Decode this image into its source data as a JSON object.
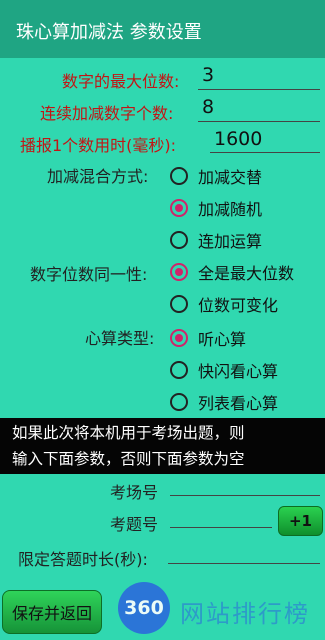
{
  "titlebar": {
    "title": "珠心算加减法 参数设置"
  },
  "fields": {
    "max_digits": {
      "label": "数字的最大位数:",
      "value": "3"
    },
    "count": {
      "label": "连续加减数字个数:",
      "value": "8"
    },
    "time": {
      "label": "播报1个数用时(毫秒):",
      "value": "1600"
    }
  },
  "mix_mode": {
    "label": "加减混合方式:",
    "options": [
      "加减交替",
      "加减随机",
      "连加运算"
    ],
    "selected": 1
  },
  "digit_mode": {
    "label": "数字位数同一性:",
    "options": [
      "全是最大位数",
      "位数可变化"
    ],
    "selected": 0
  },
  "calc_type": {
    "label": "心算类型:",
    "options": [
      "听心算",
      "快闪看心算",
      "列表看心算"
    ],
    "selected": 0
  },
  "notice": {
    "line1": "如果此次将本机用于考场出题，则",
    "line2": "输入下面参数，否则下面参数为空"
  },
  "exam": {
    "room_label": "考场号",
    "room_value": "",
    "question_label": "考题号",
    "question_value": "",
    "plus_label": "+1",
    "duration_label": "限定答题时长(秒):",
    "duration_value": ""
  },
  "footer": {
    "save_label": "保存并返回"
  },
  "watermark": {
    "badge": "360",
    "text": "网站排行榜"
  },
  "colors": {
    "background": "#30d8b0",
    "titlebar": "#1fa583",
    "selected": "#d0246a",
    "button": "#1fb344",
    "label_red": "#c21515"
  }
}
